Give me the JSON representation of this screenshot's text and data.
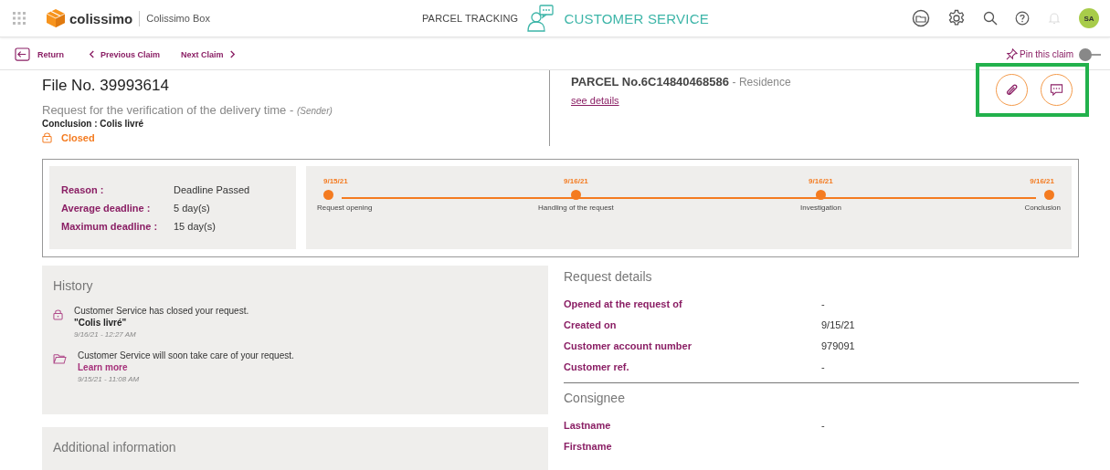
{
  "header": {
    "brand": "colissimo",
    "app_name": "Colissimo Box",
    "nav": [
      {
        "label": "PARCEL TRACKING",
        "selected": false
      },
      {
        "label": "CUSTOMER SERVICE",
        "selected": true
      }
    ],
    "avatar": "SA"
  },
  "claim_nav": {
    "return": "Return",
    "previous": "Previous Claim",
    "next": "Next Claim",
    "pin": {
      "label": "Pin this claim",
      "on": false
    }
  },
  "file": {
    "title": "File No. 39993614",
    "request": "Request for the verification of the delivery time - ",
    "request_role": "(Sender)",
    "conclusion": "Conclusion : Colis livré",
    "status": "Closed"
  },
  "parcel": {
    "number": "PARCEL No.6C14840468586",
    "type": "- Residence",
    "link": "see details"
  },
  "actions": {
    "highlighted": true
  },
  "deadlines": [
    {
      "label": "Reason :",
      "value": "Deadline Passed"
    },
    {
      "label": "Average deadline :",
      "value": "5 day(s)"
    },
    {
      "label": "Maximum deadline :",
      "value": "15 day(s)"
    }
  ],
  "timeline": [
    {
      "date": "9/15/21",
      "label": "Request opening"
    },
    {
      "date": "9/16/21",
      "label": "Handling of the request"
    },
    {
      "date": "9/16/21",
      "label": "Investigation"
    },
    {
      "date": "9/16/21",
      "label": "Conclusion"
    }
  ],
  "history": {
    "title": "History",
    "events": [
      {
        "kind": "closed",
        "text": "Customer Service has closed your request.",
        "quote": "\"Colis livré\"",
        "time": "9/16/21 - 12:27 AM"
      },
      {
        "kind": "opened",
        "text": "Customer Service will soon take care of your request.",
        "link": "Learn more",
        "time": "9/15/21 - 11:08 AM"
      }
    ]
  },
  "additional_info": {
    "title": "Additional information"
  },
  "request_details": {
    "title": "Request details",
    "rows": [
      {
        "label": "Opened at the request of",
        "value": "-"
      },
      {
        "label": "Created on",
        "value": "9/15/21"
      },
      {
        "label": "Customer account number",
        "value": "979091"
      },
      {
        "label": "Customer ref.",
        "value": "-"
      }
    ]
  },
  "consignee": {
    "title": "Consignee",
    "rows": [
      {
        "label": "Lastname",
        "value": "-"
      },
      {
        "label": "Firstname"
      }
    ]
  }
}
